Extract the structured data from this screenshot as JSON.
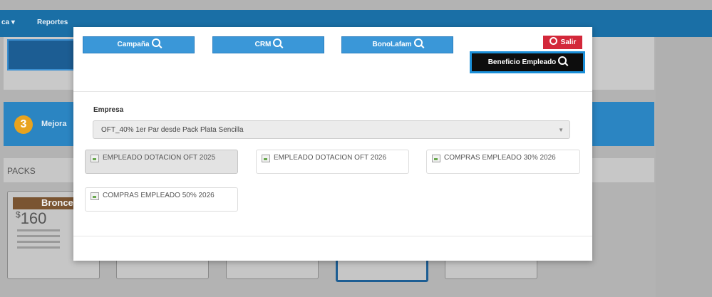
{
  "nav": {
    "item1": "ca ▾",
    "item2": "Reportes"
  },
  "background": {
    "step_number": "3",
    "step_label": "Mejora",
    "packs_label": "PACKS",
    "bronce_title": "Bronce",
    "bronce_currency": "$",
    "bronce_price": "160"
  },
  "modal": {
    "buttons": {
      "campania": "Campaña",
      "crm": "CRM",
      "bonolafam": "BonoLafam",
      "salir": "Salir",
      "beneficio": "Beneficio Empleado"
    },
    "empresa_label": "Empresa",
    "empresa_value": "OFT_40% 1er Par desde Pack Plata Sencilla",
    "options": [
      "EMPLEADO DOTACION OFT 2025",
      "EMPLEADO DOTACION OFT 2026",
      "COMPRAS EMPLEADO 30% 2026",
      "COMPRAS EMPLEADO 50% 2026"
    ]
  },
  "icons": [
    "search-icon",
    "power-icon",
    "image-placeholder-icon",
    "caret-down-icon"
  ],
  "colors": {
    "primary": "#3a97d8",
    "danger": "#d3283a",
    "dark": "#0d0d0d",
    "topbar": "#1a6fa6"
  }
}
